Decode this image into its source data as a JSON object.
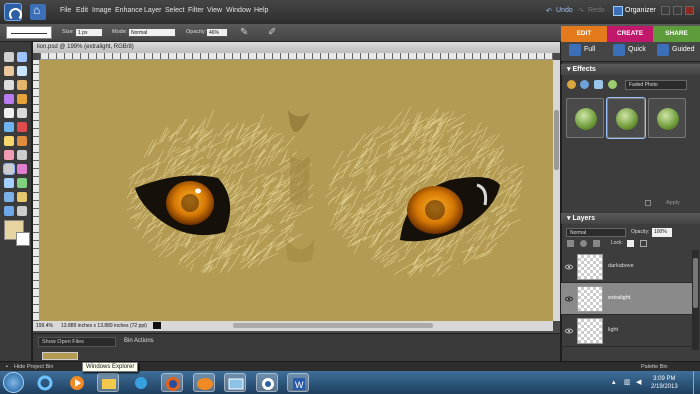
{
  "menubar": {
    "items": [
      "File",
      "Edit",
      "Image",
      "Enhance",
      "Layer",
      "Select",
      "Filter",
      "View",
      "Window",
      "Help"
    ],
    "undo_label": "Undo",
    "redo_label": "Redo",
    "organizer_label": "Organizer"
  },
  "options": {
    "size_label": "Size:",
    "size_value": "1 px",
    "mode_label": "Mode:",
    "mode_value": "Normal",
    "opacity_label": "Opacity:",
    "opacity_value": "46%"
  },
  "mode_tabs": [
    {
      "label": "EDIT",
      "color": "#e37a1c"
    },
    {
      "label": "CREATE",
      "color": "#c2186b"
    },
    {
      "label": "SHARE",
      "color": "#5c9c3b"
    }
  ],
  "edit_modes": [
    "Full",
    "Quick",
    "Guided"
  ],
  "document": {
    "title": "lion.psd @ 199% (extralight, RGB/8)",
    "zoom": "199.4%",
    "dimensions": "13.889 inches x 13.889 inches (72 ppi)"
  },
  "bin": {
    "show_label": "Show Open Files",
    "actions_label": "Bin Actions"
  },
  "effects": {
    "header": "Effects",
    "filter_value": "Faded Photo",
    "apply_label": "Apply"
  },
  "layers": {
    "header": "Layers",
    "blend_mode": "Normal",
    "opacity_label": "Opacity:",
    "opacity_value": "100%",
    "lock_label": "Lock:",
    "items": [
      {
        "name": "darkabove",
        "selected": false
      },
      {
        "name": "extralight",
        "selected": true
      },
      {
        "name": "light",
        "selected": false
      }
    ]
  },
  "footer": {
    "hide_bin_label": "Hide Project Bin",
    "palette_bin_label": "Palette Bin"
  },
  "taskbar": {
    "tooltip": "Windows Explorer",
    "time": "3:09 PM",
    "date": "2/19/2013"
  }
}
